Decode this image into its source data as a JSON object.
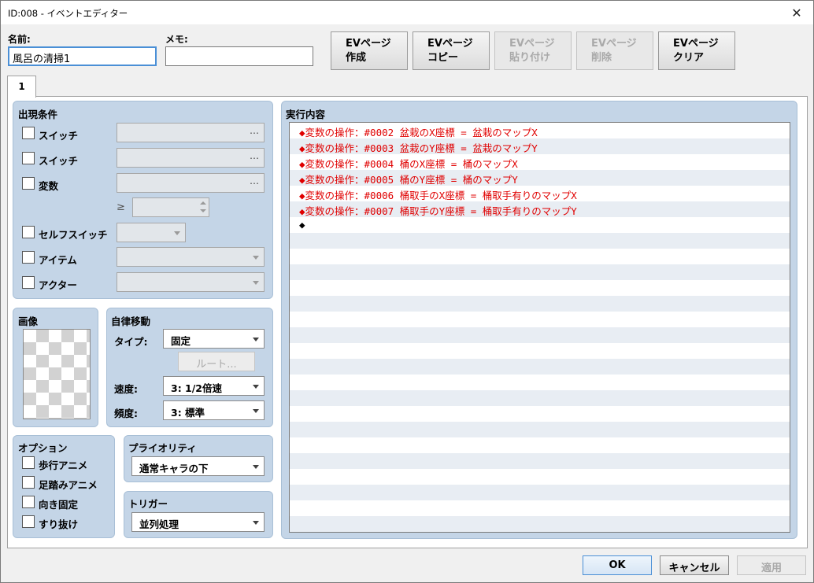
{
  "window": {
    "title": "ID:008 - イベントエディター",
    "close_glyph": "✕"
  },
  "header": {
    "name_label": "名前:",
    "name_value": "風呂の清掃1",
    "memo_label": "メモ:",
    "memo_value": ""
  },
  "ev_buttons": [
    {
      "line1": "EVページ",
      "line2": "作成",
      "enabled": true
    },
    {
      "line1": "EVページ",
      "line2": "コピー",
      "enabled": true
    },
    {
      "line1": "EVページ",
      "line2": "貼り付け",
      "enabled": false
    },
    {
      "line1": "EVページ",
      "line2": "削除",
      "enabled": false
    },
    {
      "line1": "EVページ",
      "line2": "クリア",
      "enabled": true
    }
  ],
  "tabs": [
    {
      "label": "1"
    }
  ],
  "conditions": {
    "title": "出現条件",
    "switch1": "スイッチ",
    "switch2": "スイッチ",
    "variable": "変数",
    "ellipsis": "…",
    "gte": "≥",
    "self_switch": "セルフスイッチ",
    "item": "アイテム",
    "actor": "アクター"
  },
  "image": {
    "title": "画像"
  },
  "autonomous": {
    "title": "自律移動",
    "type_label": "タイプ:",
    "type_value": "固定",
    "route_button": "ルート...",
    "speed_label": "速度:",
    "speed_value": "3: 1/2倍速",
    "freq_label": "頻度:",
    "freq_value": "3: 標準"
  },
  "options": {
    "title": "オプション",
    "walk_anim": "歩行アニメ",
    "step_anim": "足踏みアニメ",
    "dir_fix": "向き固定",
    "through": "すり抜け"
  },
  "priority": {
    "title": "プライオリティ",
    "value": "通常キャラの下"
  },
  "trigger": {
    "title": "トリガー",
    "value": "並列処理"
  },
  "contents": {
    "title": "実行内容",
    "commands": [
      "◆変数の操作：#0002 盆栽のX座標 = 盆栽のマップX",
      "◆変数の操作：#0003 盆栽のY座標 = 盆栽のマップY",
      "◆変数の操作：#0004 桶のX座標 = 桶のマップX",
      "◆変数の操作：#0005 桶のY座標 = 桶のマップY",
      "◆変数の操作：#0006 桶取手のX座標 = 桶取手有りのマップX",
      "◆変数の操作：#0007 桶取手のY座標 = 桶取手有りのマップY",
      "◆"
    ]
  },
  "footer": {
    "ok": "OK",
    "cancel": "キャンセル",
    "apply": "適用"
  },
  "colors": {
    "command_text": "#e00000",
    "panel_bg": "#c4d5e7",
    "focus_border": "#4a8fd6"
  }
}
